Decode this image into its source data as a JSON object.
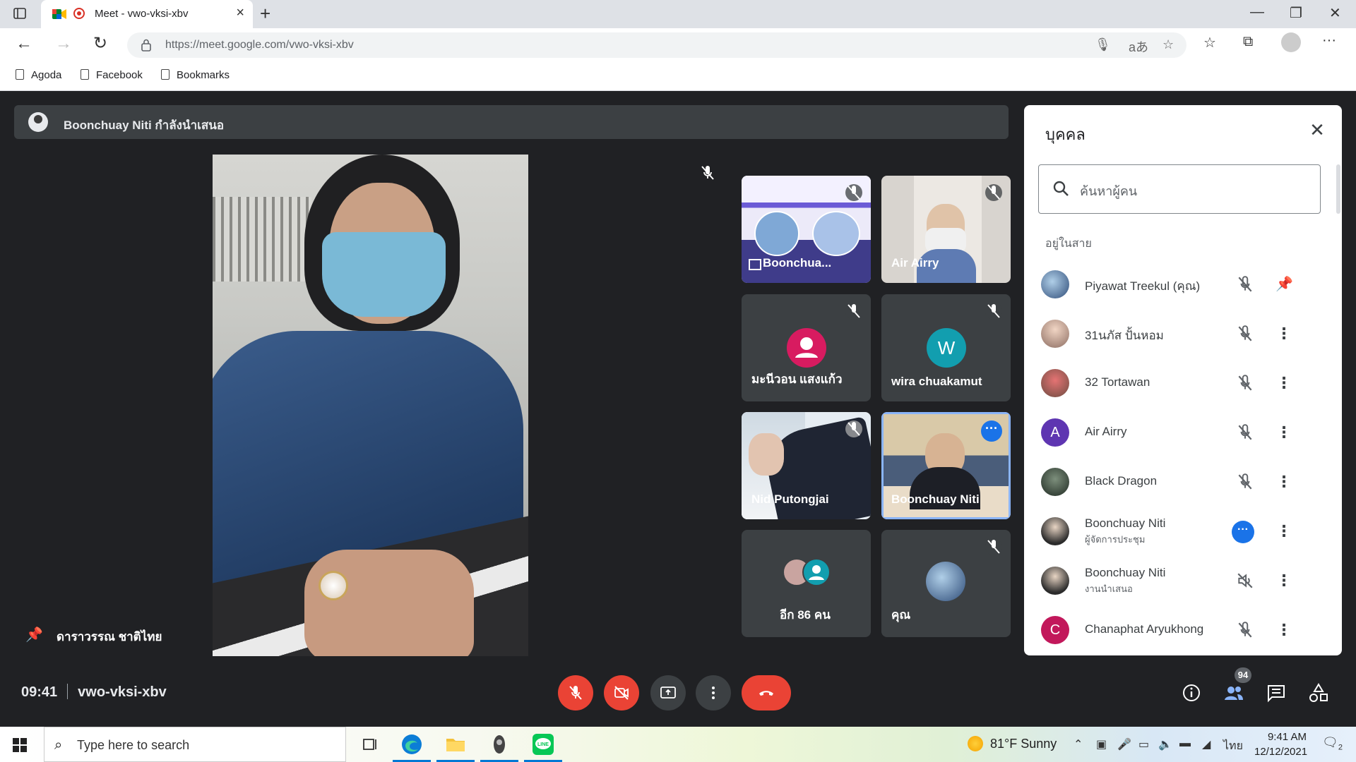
{
  "browser": {
    "tab_title": "Meet - vwo-vksi-xbv",
    "url": "https://meet.google.com/vwo-vksi-xbv",
    "read_aloud_glyph": "aあ",
    "bookmarks": [
      "Agoda",
      "Facebook",
      "Bookmarks"
    ]
  },
  "meet": {
    "presenter_banner": "Boonchuay Niti กำลังนำเสนอ",
    "pinned_name": "ดาราวรรณ ชาติไทย",
    "time": "09:41",
    "meeting_code": "vwo-vksi-xbv",
    "tiles": [
      {
        "name": "Boonchua...",
        "muted": true
      },
      {
        "name": "Air Airry",
        "muted": true
      },
      {
        "name": "มะนีวอน แสงแก้ว",
        "muted": true,
        "avatar_color": "#d81b60"
      },
      {
        "name": "wira chuakamut",
        "muted": true,
        "avatar_letter": "W",
        "avatar_color": "#129eaf"
      },
      {
        "name": "Nid Putongjai",
        "muted": true
      },
      {
        "name": "Boonchuay Niti",
        "muted": false,
        "active": true
      },
      {
        "name": "อีก 86 คน"
      },
      {
        "name": "คุณ",
        "muted": true
      }
    ],
    "people_count": "94",
    "colors": {
      "hangup": "#ea4335",
      "accent": "#1a73e8",
      "bg": "#202124",
      "tile": "#3c4043"
    }
  },
  "panel": {
    "title": "บุคคล",
    "search_placeholder": "ค้นหาผู้คน",
    "section": "อยู่ในสาย",
    "people": [
      {
        "name": "Piyawat Treekul (คุณ)",
        "sub": "",
        "muted": true,
        "action": "pin"
      },
      {
        "name": "31นภัส ปั้นหอม",
        "sub": "",
        "muted": true,
        "action": "more"
      },
      {
        "name": "32 Tortawan",
        "sub": "",
        "muted": true,
        "action": "more"
      },
      {
        "name": "Air Airry",
        "sub": "",
        "muted": true,
        "action": "more",
        "letter": "A",
        "color": "#5e35b1"
      },
      {
        "name": "Black Dragon",
        "sub": "",
        "muted": true,
        "action": "more"
      },
      {
        "name": "Boonchuay Niti",
        "sub": "ผู้จัดการประชุม",
        "muted": false,
        "action": "more"
      },
      {
        "name": "Boonchuay Niti",
        "sub": "งานนำเสนอ",
        "muted": true,
        "action": "more"
      },
      {
        "name": "Chanaphat Aryukhong",
        "sub": "",
        "muted": true,
        "action": "more",
        "letter": "C",
        "color": "#c2185b"
      }
    ]
  },
  "taskbar": {
    "search_placeholder": "Type here to search",
    "weather": "81°F  Sunny",
    "lang": "ไทย",
    "time": "9:41 AM",
    "date": "12/12/2021",
    "notifications": "2"
  }
}
